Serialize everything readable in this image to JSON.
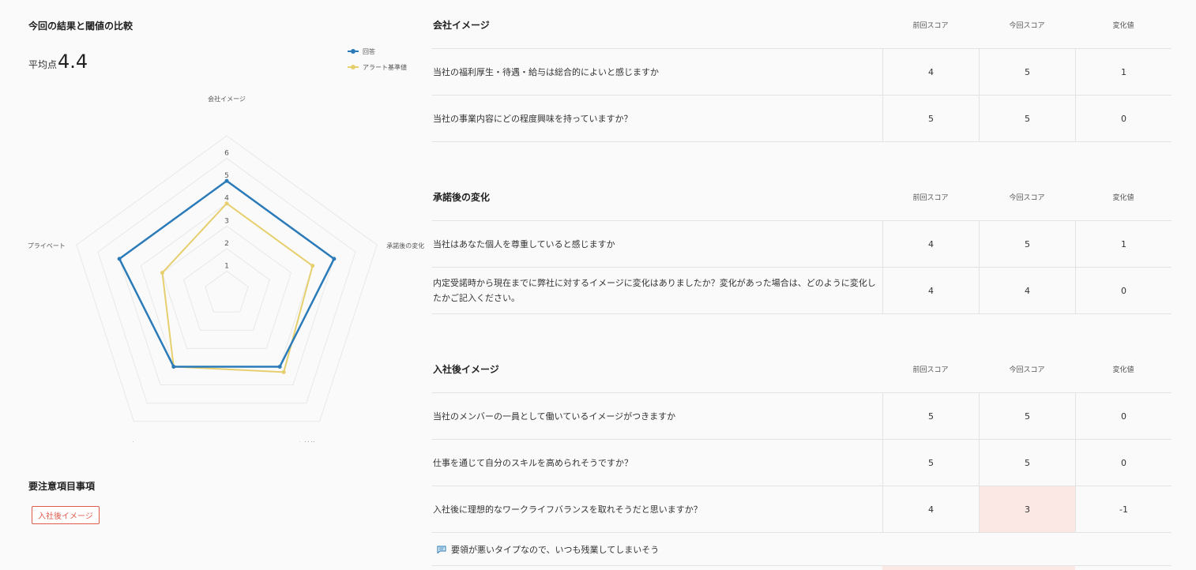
{
  "left": {
    "title": "今回の結果と閾値の比較",
    "average_label": "平均点",
    "average_value": "4.4",
    "legend": [
      {
        "label": "回答",
        "color": "#2b7bb9"
      },
      {
        "label": "アラート基準値",
        "color": "#e6cf6e"
      }
    ],
    "warning_title": "要注意項目事項",
    "warning_tags": [
      "入社後イメージ"
    ]
  },
  "chart_data": {
    "type": "radar",
    "axes": [
      "会社イメージ",
      "承諾後の変化",
      "入社後イメージ",
      "コミュニケーション",
      "プライベート"
    ],
    "r_ticks": [
      "1",
      "2",
      "3",
      "4",
      "5",
      "6"
    ],
    "r_max": 6,
    "series": [
      {
        "name": "回答",
        "values": [
          5,
          5,
          4,
          4,
          5
        ],
        "color": "#2b7bb9"
      },
      {
        "name": "アラート基準値",
        "values": [
          4,
          4,
          4.3,
          4,
          3
        ],
        "color": "#e6cf6e"
      }
    ]
  },
  "table": {
    "column_headers": [
      "前回スコア",
      "今回スコア",
      "変化値"
    ],
    "sections": [
      {
        "title": "会社イメージ",
        "rows": [
          {
            "question": "当社の福利厚生・待遇・給与は総合的によいと感じますか",
            "prev": "4",
            "curr": "5",
            "change": "1"
          },
          {
            "question": "当社の事業内容にどの程度興味を持っていますか？",
            "prev": "5",
            "curr": "5",
            "change": "0"
          }
        ]
      },
      {
        "title": "承諾後の変化",
        "rows": [
          {
            "question": "当社はあなた個人を尊重していると感じますか",
            "prev": "4",
            "curr": "5",
            "change": "1"
          },
          {
            "question": "内定受諾時から現在までに弊社に対するイメージに変化はありましたか？変化があった場合は、どのように変化したかご記入ください。",
            "prev": "4",
            "curr": "4",
            "change": "0"
          }
        ]
      },
      {
        "title": "入社後イメージ",
        "rows": [
          {
            "question": "当社のメンバーの一員として働いているイメージがつきますか",
            "prev": "5",
            "curr": "5",
            "change": "0"
          },
          {
            "question": "仕事を通じて自分のスキルを高められそうですか？",
            "prev": "5",
            "curr": "5",
            "change": "0"
          },
          {
            "question": "入社後に理想的なワークライフバランスを取れそうだと思いますか？",
            "prev": "4",
            "curr": "3",
            "change": "-1",
            "alert": true
          }
        ],
        "comment": "要領が悪いタイプなので、いつも残業してしまいそう"
      }
    ]
  }
}
